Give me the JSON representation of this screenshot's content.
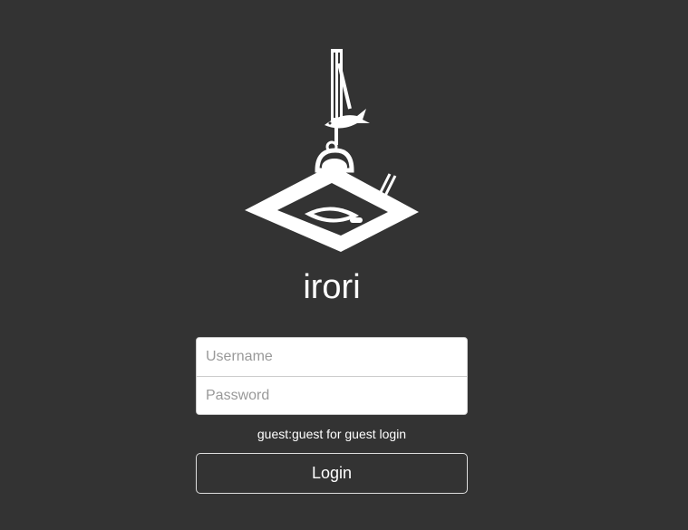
{
  "app": {
    "title": "irori",
    "logo_icon": "irori-hearth-logo-icon"
  },
  "login_form": {
    "username_placeholder": "Username",
    "username_value": "",
    "password_placeholder": "Password",
    "password_value": "",
    "hint": "guest:guest for guest login",
    "login_label": "Login"
  },
  "colors": {
    "background": "#333333",
    "text": "#ffffff",
    "button_border": "#dddddd",
    "input_border": "#cccccc",
    "placeholder": "#999999"
  }
}
